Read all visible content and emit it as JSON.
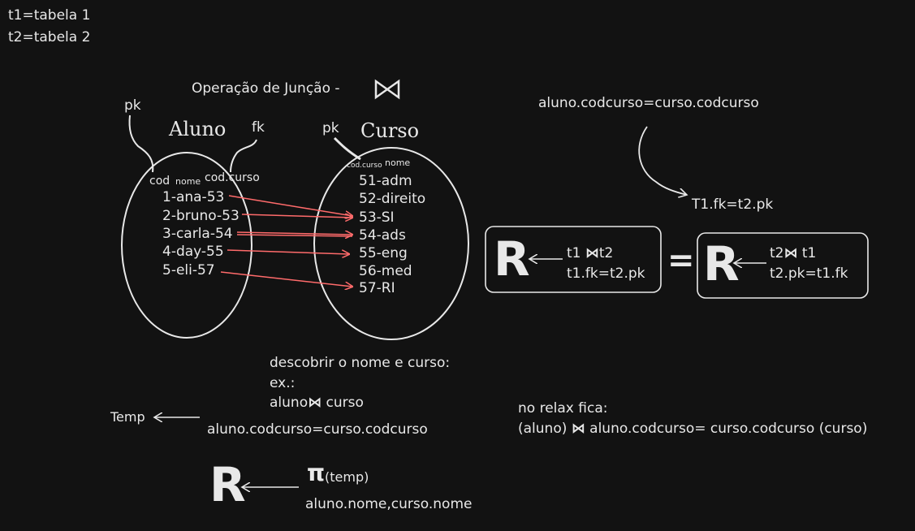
{
  "legend": {
    "line1": "t1=tabela 1",
    "line2": "t2=tabela 2"
  },
  "heading": {
    "text": "Operação de Junção - ",
    "symbol": "⋈"
  },
  "aluno": {
    "pk_label": "pk",
    "fk_label": "fk",
    "title": "Aluno",
    "col_cod": "cod",
    "col_nome": "nome",
    "col_codcurso": "cod.curso",
    "rows": [
      "1-ana-53",
      "2-bruno-53",
      "3-carla-54",
      "4-day-55",
      "5-eli-57"
    ]
  },
  "curso": {
    "pk_label": "pk",
    "title": "Curso",
    "col_codcurso": "cod.curso",
    "col_nome": "nome",
    "rows": [
      "51-adm",
      "52-direito",
      "53-SI",
      "54-ads",
      "55-eng",
      "56-med",
      "57-RI"
    ]
  },
  "right_notes": {
    "condition": "aluno.codcurso=curso.codcurso",
    "fk_pk": "T1.fk=t2.pk"
  },
  "formula_left": {
    "r": "R",
    "line1_a": "t1 ",
    "line1_sym": "⋈",
    "line1_b": "t2",
    "line2": "t1.fk=t2.pk"
  },
  "equals": "=",
  "formula_right": {
    "r": "R",
    "line1_a": "t2",
    "line1_sym": "⋈",
    "line1_b": " t1",
    "line2": "t2.pk=t1.fk"
  },
  "example": {
    "line1": "descobrir o nome e curso:",
    "line2": "ex.:",
    "line3_a": "aluno",
    "line3_sym": "⋈",
    "line3_b": " curso"
  },
  "temp": {
    "label": "Temp",
    "condition": "aluno.codcurso=curso.codcurso"
  },
  "relax": {
    "line1": "no relax fica:",
    "line2_a": "(aluno) ",
    "line2_sym": "⋈",
    "line2_b": " aluno.codcurso= curso.codcurso (curso)"
  },
  "projection": {
    "r": "R",
    "pi": "π",
    "arg": "(temp)",
    "attrs": "aluno.nome,curso.nome"
  },
  "colors": {
    "ink": "#e8e8e8",
    "arrow": "#ff6b6b",
    "background": "#121212"
  }
}
